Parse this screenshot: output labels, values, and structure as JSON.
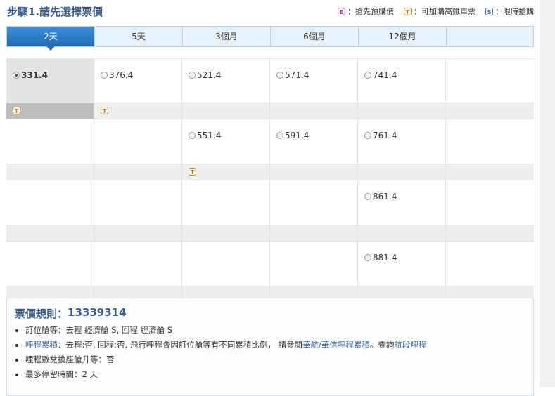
{
  "header": {
    "title": "步驟1.請先選擇票價",
    "legend": [
      {
        "badge": "E",
        "label": "：搶先預購價"
      },
      {
        "badge": "T",
        "label": "：可加購高鐵車票"
      },
      {
        "badge": "S",
        "label": "：限時搶購"
      }
    ]
  },
  "tabs": [
    "2天",
    "5天",
    "3個月",
    "6個月",
    "12個月"
  ],
  "active_tab": "2天",
  "fare_rows": [
    {
      "fares": [
        "331.4",
        "376.4",
        "521.4",
        "571.4",
        "741.4",
        ""
      ],
      "badges": [
        "T",
        "T",
        "",
        "",
        "",
        ""
      ]
    },
    {
      "fares": [
        "",
        "",
        "551.4",
        "591.4",
        "761.4",
        ""
      ],
      "badges": [
        "",
        "",
        "T",
        "",
        "",
        ""
      ]
    },
    {
      "fares": [
        "",
        "",
        "",
        "",
        "861.4",
        ""
      ],
      "badges": [
        "",
        "",
        "",
        "",
        "",
        ""
      ]
    },
    {
      "fares": [
        "",
        "",
        "",
        "",
        "881.4",
        ""
      ],
      "badges": [
        "",
        "",
        "",
        "",
        "",
        ""
      ]
    }
  ],
  "selected_fare": "331.4",
  "rules": {
    "title_prefix": "票價規則：",
    "rule_id": "13339314",
    "items": {
      "class": "訂位艙等：去程 經濟艙 S, 回程 經濟艙 S",
      "mileage_link": "哩程累積",
      "mileage_text": "：去程:否, 回程:否, 飛行哩程會因訂位艙等有不同累積比例，  請參閱",
      "mileage_ref_link": "華航/華信哩程累積",
      "mileage_sep": "。查詢",
      "mileage_route_link": "航段哩程",
      "upgrade": "哩程數兌換座艙升等：否",
      "stay": "最多停留時間：2 天"
    }
  }
}
